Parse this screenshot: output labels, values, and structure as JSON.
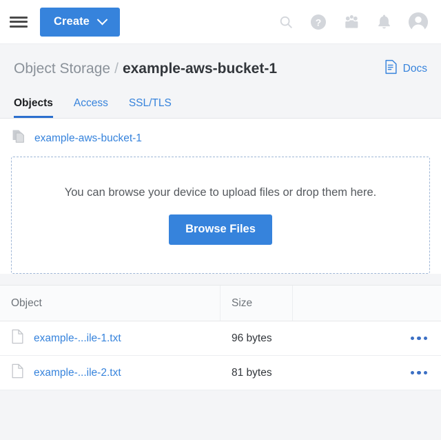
{
  "topbar": {
    "menu_icon": "hamburger-menu-icon",
    "create_label": "Create",
    "create_caret_icon": "chevron-down-icon",
    "icons": [
      {
        "name": "search-icon"
      },
      {
        "name": "help-icon"
      },
      {
        "name": "community-icon"
      },
      {
        "name": "notifications-bell-icon"
      },
      {
        "name": "user-avatar-icon"
      }
    ],
    "accent_color": "#3683dc"
  },
  "header": {
    "breadcrumb_parent": "Object Storage",
    "breadcrumb_separator": "/",
    "breadcrumb_current": "example-aws-bucket-1",
    "docs_label": "Docs",
    "docs_icon": "document-icon"
  },
  "tabs": [
    {
      "label": "Objects",
      "active": true
    },
    {
      "label": "Access",
      "active": false
    },
    {
      "label": "SSL/TLS",
      "active": false
    }
  ],
  "bucket_path": {
    "copy_icon": "copy-pages-icon",
    "name": "example-aws-bucket-1"
  },
  "dropzone": {
    "message": "You can browse your device to upload files or drop them here.",
    "button_label": "Browse Files",
    "border_color": "#9fb6d6"
  },
  "table": {
    "columns": [
      "Object",
      "Size",
      ""
    ],
    "rows": [
      {
        "file_icon": "file-document-icon",
        "object": "example-...ile-1.txt",
        "size": "96 bytes",
        "menu_icon": "kebab-menu-icon"
      },
      {
        "file_icon": "file-document-icon",
        "object": "example-...ile-2.txt",
        "size": "81 bytes",
        "menu_icon": "kebab-menu-icon"
      }
    ]
  }
}
